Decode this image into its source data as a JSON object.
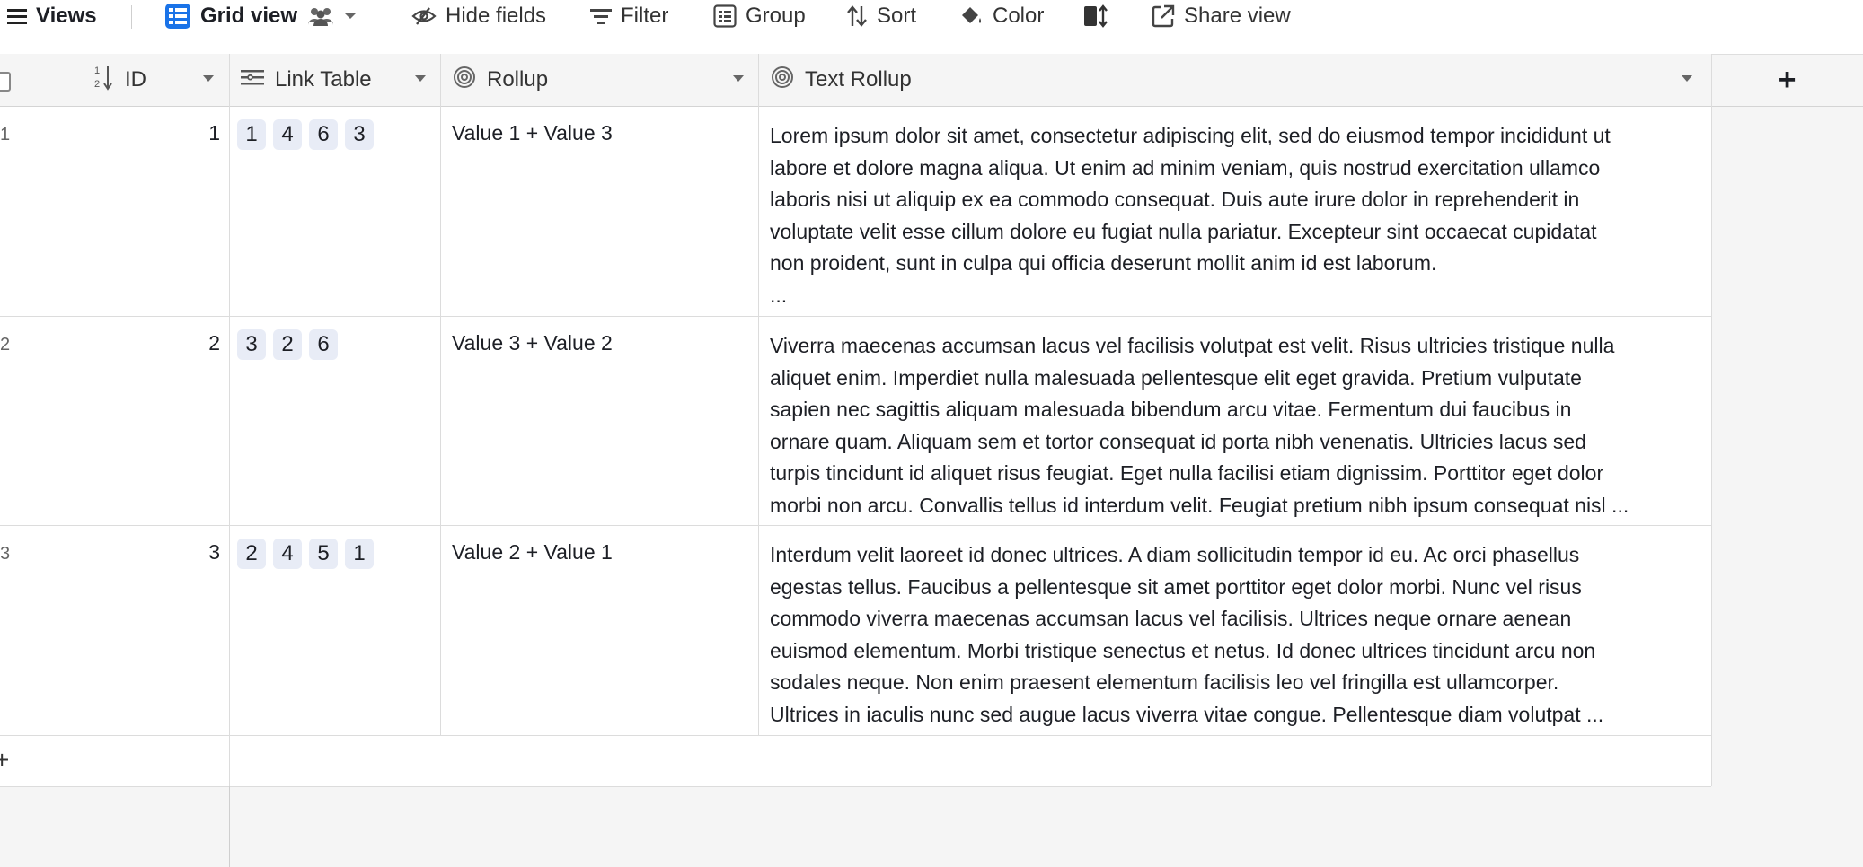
{
  "toolbar": {
    "views_label": "Views",
    "grid_view_label": "Grid view",
    "hide_fields_label": "Hide fields",
    "filter_label": "Filter",
    "group_label": "Group",
    "sort_label": "Sort",
    "color_label": "Color",
    "share_view_label": "Share view",
    "accent_color": "#1a73e8"
  },
  "columns": [
    {
      "label": "ID",
      "icon": "number-sort-icon"
    },
    {
      "label": "Link Table",
      "icon": "link-lines-icon"
    },
    {
      "label": "Rollup",
      "icon": "spiral-icon"
    },
    {
      "label": "Text Rollup",
      "icon": "spiral-icon"
    }
  ],
  "add_column_label": "+",
  "rows": [
    {
      "row_number": "1",
      "id": "1",
      "links": [
        "1",
        "4",
        "6",
        "3"
      ],
      "rollup": "Value 1 + Value 3",
      "text": "Lorem ipsum dolor sit amet, consectetur adipiscing elit, sed do eiusmod tempor incididunt ut\nlabore et dolore magna aliqua. Ut enim ad minim veniam, quis nostrud exercitation ullamco\nlaboris nisi ut aliquip ex ea commodo consequat. Duis aute irure dolor in reprehenderit in\nvoluptate velit esse cillum dolore eu fugiat nulla pariatur. Excepteur sint occaecat cupidatat\nnon proident, sunt in culpa qui officia deserunt mollit anim id est laborum.\n..."
    },
    {
      "row_number": "2",
      "id": "2",
      "links": [
        "3",
        "2",
        "6"
      ],
      "rollup": "Value 3 + Value 2",
      "text": "Viverra maecenas accumsan lacus vel facilisis volutpat est velit. Risus ultricies tristique nulla\naliquet enim. Imperdiet nulla malesuada pellentesque elit eget gravida. Pretium vulputate\nsapien nec sagittis aliquam malesuada bibendum arcu vitae. Fermentum dui faucibus in\nornare quam. Aliquam sem et tortor consequat id porta nibh venenatis. Ultricies lacus sed\nturpis tincidunt id aliquet risus feugiat. Eget nulla facilisi etiam dignissim. Porttitor eget dolor\nmorbi non arcu. Convallis tellus id interdum velit. Feugiat pretium nibh ipsum consequat nisl ..."
    },
    {
      "row_number": "3",
      "id": "3",
      "links": [
        "2",
        "4",
        "5",
        "1"
      ],
      "rollup": "Value 2 + Value 1",
      "text": "Interdum velit laoreet id donec ultrices. A diam sollicitudin tempor id eu. Ac orci phasellus\negestas tellus. Faucibus a pellentesque sit amet porttitor eget dolor morbi. Nunc vel risus\ncommodo viverra maecenas accumsan lacus vel facilisis. Ultrices neque ornare aenean\neuismod elementum. Morbi tristique senectus et netus. Id donec ultrices tincidunt arcu non\nsodales neque. Non enim praesent elementum facilisis leo vel fringilla est ullamcorper.\nUltrices in iaculis nunc sed augue lacus viverra vitae congue. Pellentesque diam volutpat ..."
    }
  ],
  "add_row_label": "+"
}
